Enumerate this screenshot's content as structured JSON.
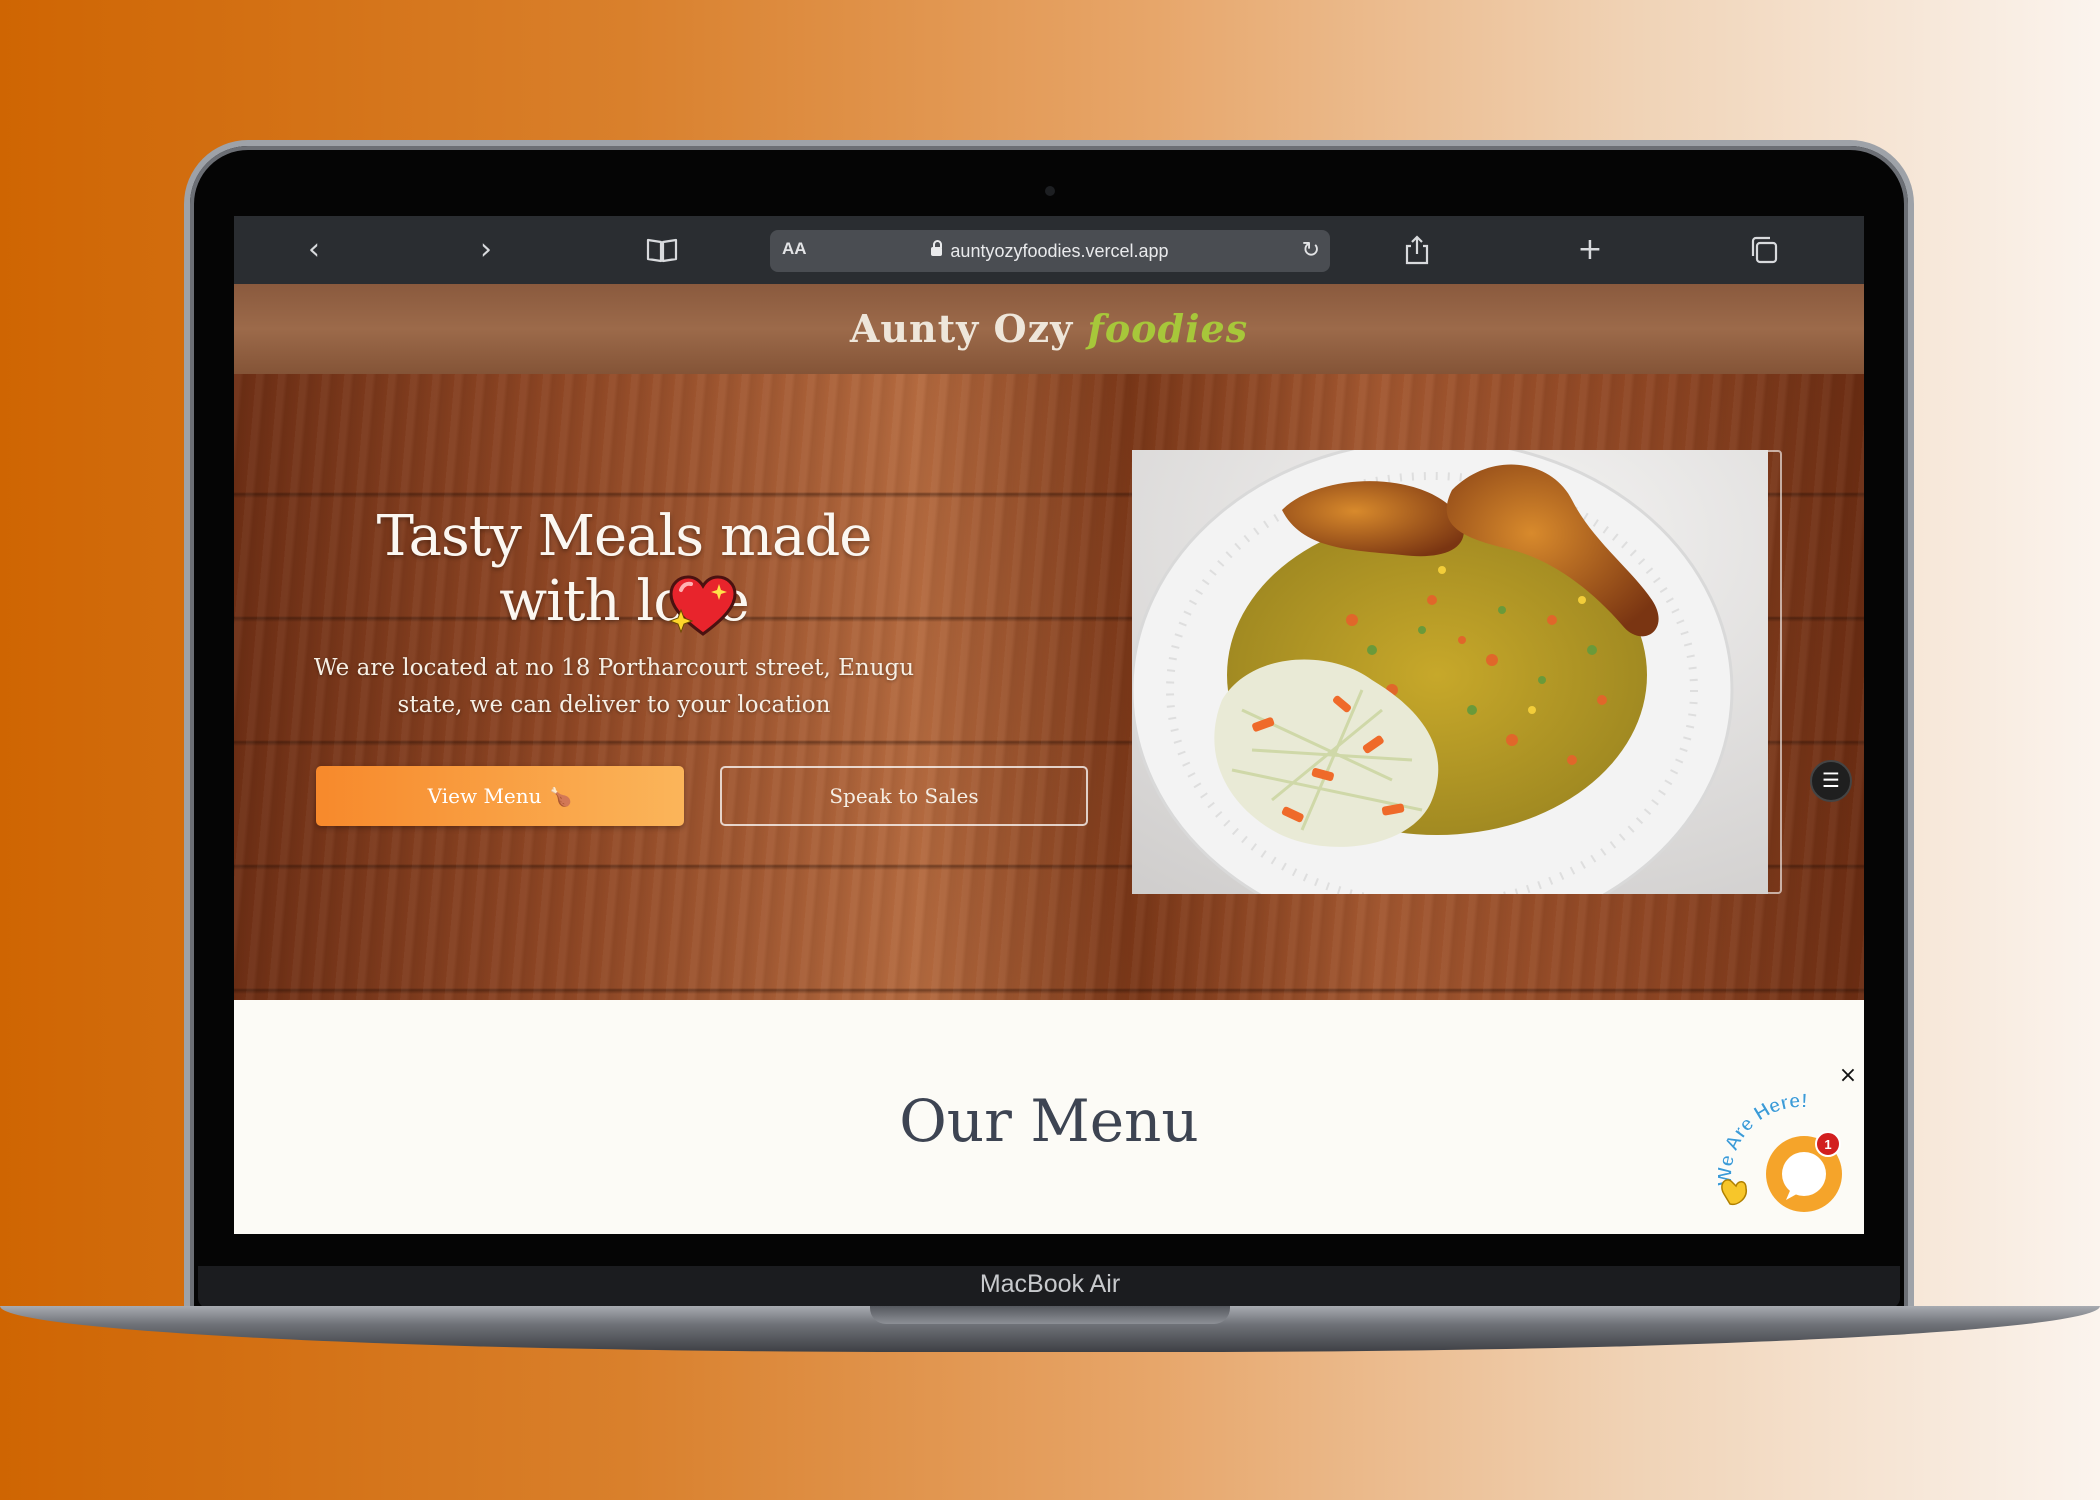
{
  "device": {
    "label": "MacBook Air"
  },
  "browser": {
    "aa_label": "AA",
    "url": "auntyozyfoodies.vercel.app",
    "icons": [
      "back-chevron-icon",
      "forward-chevron-icon",
      "bookmarks-book-icon",
      "lock-icon",
      "reload-icon",
      "share-icon",
      "new-tab-plus-icon",
      "tabs-icon"
    ]
  },
  "header": {
    "brand_main": "Aunty Ozy",
    "brand_accent": "foodies"
  },
  "hero": {
    "title": "Tasty Meals made with love",
    "subtitle": "We are located at no 18 Portharcourt street, Enugu state, we can deliver to your location",
    "primary_button": "View Menu",
    "primary_button_icon": "🍗",
    "secondary_button": "Speak to Sales"
  },
  "menu_section": {
    "title": "Our Menu"
  },
  "chat_widget": {
    "label": "We Are Here!",
    "badge_count": "1",
    "close_label": "×"
  },
  "colors": {
    "brand_accent": "#a7c73a",
    "primary_button": "#f7892b",
    "chat_orange": "#f5a42a"
  }
}
